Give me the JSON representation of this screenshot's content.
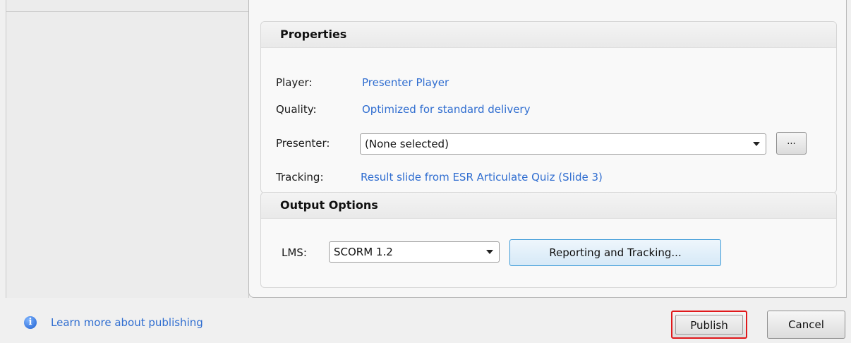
{
  "properties": {
    "heading": "Properties",
    "player_label": "Player:",
    "player_value": "Presenter Player",
    "quality_label": "Quality:",
    "quality_value": "Optimized for standard delivery",
    "presenter_label": "Presenter:",
    "presenter_selected": "(None selected)",
    "presenter_more": "...",
    "tracking_label": "Tracking:",
    "tracking_value": "Result slide from ESR Articulate Quiz (Slide 3)"
  },
  "output_options": {
    "heading": "Output Options",
    "lms_label": "LMS:",
    "lms_selected": "SCORM 1.2",
    "reporting_button": "Reporting and Tracking..."
  },
  "footer": {
    "learn_more_link": "Learn more about publishing",
    "info_icon_glyph": "i",
    "publish_button": "Publish",
    "cancel_button": "Cancel"
  },
  "colors": {
    "link": "#2f6dd0",
    "highlight_border": "#e0181b",
    "primary_button_border": "#3c9ad8"
  }
}
